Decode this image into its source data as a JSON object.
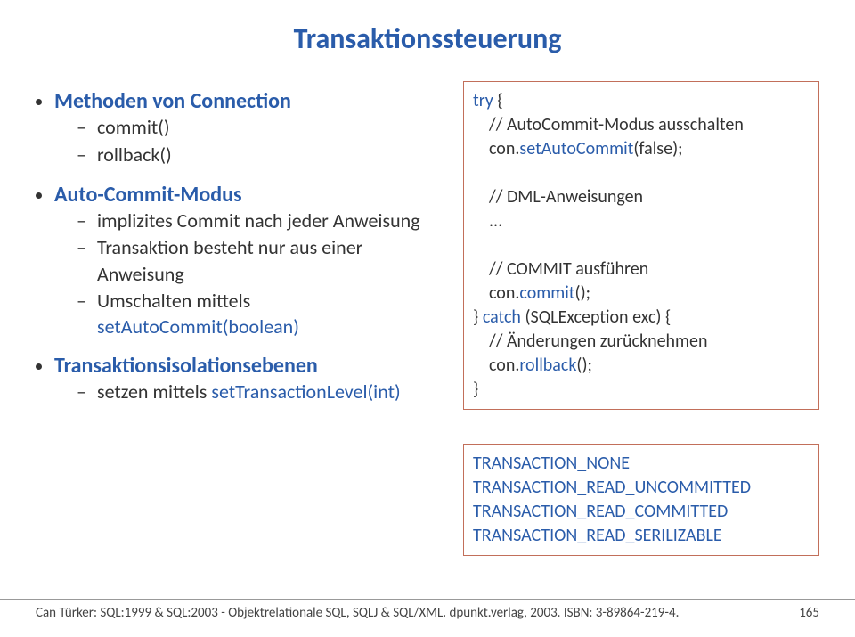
{
  "title": "Transaktionssteuerung",
  "left": {
    "sec1": {
      "heading": "Methoden von Connection",
      "items": {
        "i1": "commit()",
        "i2": "rollback()"
      }
    },
    "sec2": {
      "heading": "Auto-Commit-Modus",
      "items": {
        "i1": "implizites Commit nach jeder Anweisung",
        "i2": "Transaktion besteht nur aus einer Anweisung",
        "i3_pre": "Umschalten mittels ",
        "i3_m": "setAutoCommit(boolean)"
      }
    },
    "sec3": {
      "heading": "Transaktionsisolationsebenen",
      "items": {
        "i1_pre": "setzen mittels ",
        "i1_m": "setTransactionLevel(int)"
      }
    }
  },
  "code": {
    "l1_kw": "try",
    "l1_rest": " {",
    "l2": "// AutoCommit-Modus ausschalten",
    "l3_pre": "con.",
    "l3_m": "setAutoCommit",
    "l3_post": "(false);",
    "l4": "// DML-Anweisungen",
    "l5": "...",
    "l6": "// COMMIT ausführen",
    "l7_pre": "con.",
    "l7_m": "commit",
    "l7_post": "();",
    "l8_a": "} ",
    "l8_kw": "catch",
    "l8_b": " (SQLException exc) {",
    "l9": "// Änderungen zurücknehmen",
    "l10_pre": "con.",
    "l10_m": "rollback",
    "l10_post": "();",
    "l11": "}"
  },
  "iso": {
    "l1": "TRANSACTION_NONE",
    "l2": "TRANSACTION_READ_UNCOMMITTED",
    "l3": "TRANSACTION_READ_COMMITTED",
    "l4": "TRANSACTION_READ_SERILIZABLE"
  },
  "footer": {
    "text": "Can Türker: SQL:1999 & SQL:2003 - Objektrelationale SQL, SQLJ & SQL/XML. dpunkt.verlag, 2003. ISBN: 3-89864-219-4.",
    "page": "165"
  }
}
